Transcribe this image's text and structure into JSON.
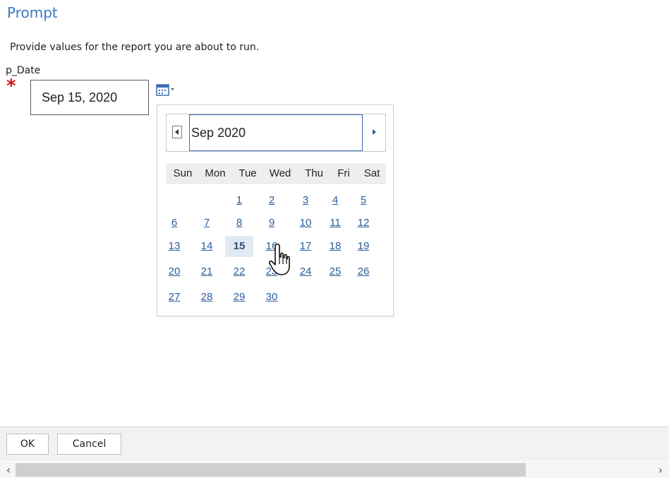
{
  "dialog": {
    "title": "Prompt",
    "instructions": "Provide values for the report you are about to run."
  },
  "parameter": {
    "label": "p_Date",
    "required_mark": "*",
    "value": "Sep 15, 2020",
    "calendar_button_icon": "calendar-dropdown-icon"
  },
  "calendar": {
    "month_label": "Sep 2020",
    "prev_icon": "triangle-left-icon",
    "next_icon": "triangle-right-icon",
    "weekdays": [
      "Sun",
      "Mon",
      "Tue",
      "Wed",
      "Thu",
      "Fri",
      "Sat"
    ],
    "weeks": [
      [
        "",
        "",
        "1",
        "2",
        "3",
        "4",
        "5"
      ],
      [
        "6",
        "7",
        "8",
        "9",
        "10",
        "11",
        "12"
      ],
      [
        "13",
        "14",
        "15",
        "16",
        "17",
        "18",
        "19"
      ],
      [
        "20",
        "21",
        "22",
        "23",
        "24",
        "25",
        "26"
      ],
      [
        "27",
        "28",
        "29",
        "30",
        "",
        "",
        ""
      ]
    ],
    "selected_day": "15"
  },
  "footer": {
    "ok_label": "OK",
    "cancel_label": "Cancel"
  },
  "scrollbar": {
    "left_arrow": "‹",
    "right_arrow": "›"
  },
  "colors": {
    "title": "#3a77c4",
    "required": "#d11a1a",
    "day_link": "#2a5c9a",
    "selected_bg": "#e3e9f2"
  }
}
